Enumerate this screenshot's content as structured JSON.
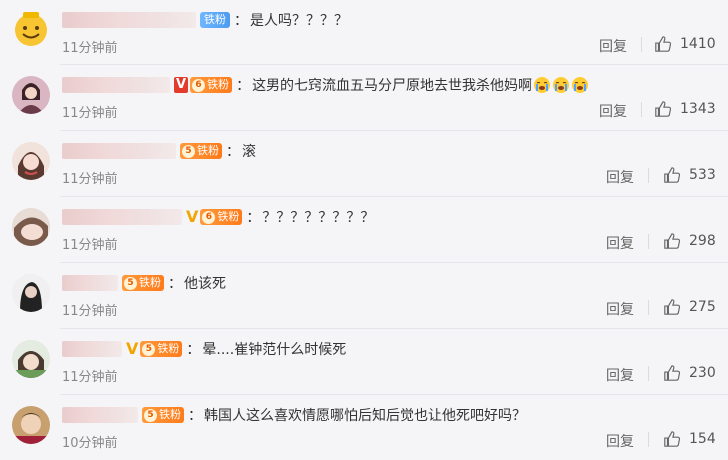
{
  "comments": [
    {
      "badge": "铁粉",
      "text": "是人吗？？？？",
      "time": "11分钟前",
      "reply": "回复",
      "likes": "1410"
    },
    {
      "badge": "铁粉",
      "text": "这男的七窍流血五马分尸原地去世我杀他妈啊",
      "time": "11分钟前",
      "reply": "回复",
      "likes": "1343"
    },
    {
      "badge": "铁粉",
      "text": "滚",
      "time": "11分钟前",
      "reply": "回复",
      "likes": "533"
    },
    {
      "badge": "铁粉",
      "text": "？？？？？？？？",
      "time": "11分钟前",
      "reply": "回复",
      "likes": "298"
    },
    {
      "badge": "铁粉",
      "text": "他该死",
      "time": "11分钟前",
      "reply": "回复",
      "likes": "275"
    },
    {
      "badge": "铁粉",
      "text": "晕....崔钟范什么时候死",
      "time": "11分钟前",
      "reply": "回复",
      "likes": "230"
    },
    {
      "badge": "铁粉",
      "text": "韩国人这么喜欢情愿哪怕后知后觉也让他死吧好吗？",
      "time": "10分钟前",
      "reply": "回复",
      "likes": "154"
    }
  ],
  "colors": {
    "badge_orange": "#ff8a2a",
    "badge_blue": "#5aa8f5",
    "vip_gold": "#f2a400",
    "vip_red": "#e23c2c"
  },
  "icons": {
    "like": "thumb-up-icon",
    "emoji": "crying-face-icon"
  }
}
